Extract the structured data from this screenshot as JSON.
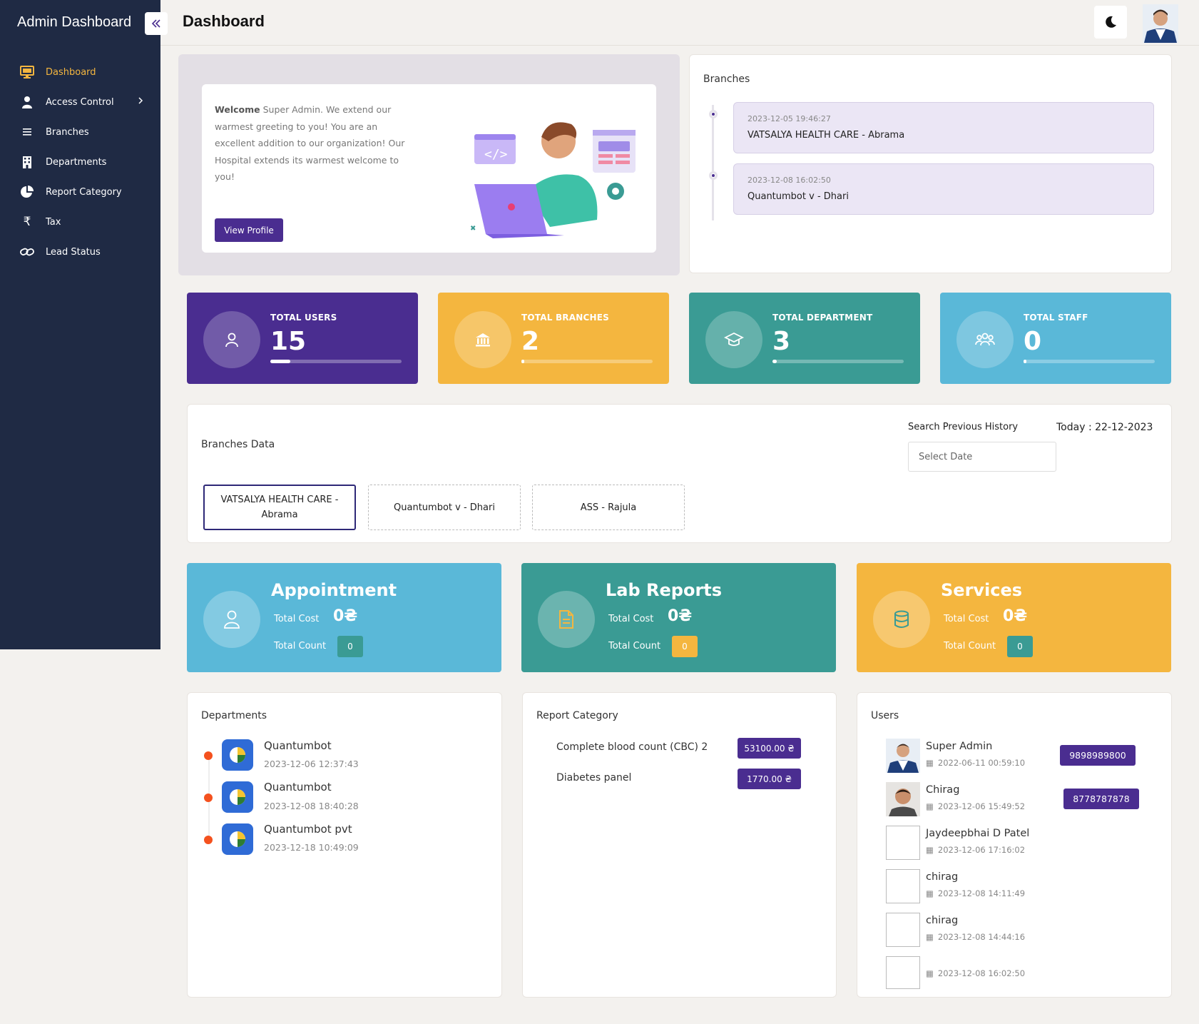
{
  "sidebar": {
    "brand": "Admin Dashboard",
    "items": [
      {
        "label": "Dashboard",
        "icon": "monitor-icon"
      },
      {
        "label": "Access Control",
        "icon": "user-icon"
      },
      {
        "label": "Branches",
        "icon": "list-icon"
      },
      {
        "label": "Departments",
        "icon": "building-icon"
      },
      {
        "label": "Report Category",
        "icon": "pie-chart-icon"
      },
      {
        "label": "Tax",
        "icon": "rupee-icon"
      },
      {
        "label": "Lead Status",
        "icon": "link-icon"
      }
    ]
  },
  "header": {
    "title": "Dashboard"
  },
  "welcome": {
    "strong": "Welcome",
    "text": " Super Admin. We extend our warmest greeting to you! You are an excellent addition to our organization! Our Hospital extends its warmest welcome to you!",
    "button": "View Profile"
  },
  "branches_panel": {
    "title": "Branches",
    "items": [
      {
        "date": "2023-12-05 19:46:27",
        "name": "VATSALYA HEALTH CARE - Abrama"
      },
      {
        "date": "2023-12-08 16:02:50",
        "name": "Quantumbot v - Dhari"
      }
    ]
  },
  "stats": [
    {
      "label": "TOTAL USERS",
      "value": "15",
      "progress": 0.15,
      "color": "#4a2d90",
      "icon": "user-icon"
    },
    {
      "label": "TOTAL BRANCHES",
      "value": "2",
      "progress": 0.02,
      "color": "#f4b63f",
      "icon": "bank-icon"
    },
    {
      "label": "TOTAL DEPARTMENT",
      "value": "3",
      "progress": 0.03,
      "color": "#3a9b94",
      "icon": "graduation-cap-icon"
    },
    {
      "label": "TOTAL STAFF",
      "value": "0",
      "progress": 0,
      "color": "#5ab8d8",
      "icon": "group-icon"
    }
  ],
  "branches_data": {
    "title": "Branches Data",
    "search_label": "Search Previous History",
    "today": "Today : 22-12-2023",
    "date_placeholder": "Select Date",
    "tabs": [
      "VATSALYA HEALTH CARE - Abrama",
      "Quantumbot v - Dhari",
      "ASS - Rajula"
    ]
  },
  "services": [
    {
      "title": "Appointment",
      "cost_label": "Total Cost",
      "cost": "0₴",
      "count_label": "Total Count",
      "count": "0",
      "color": "#5ab8d8",
      "badge_color": "#3a9b94",
      "icon": "user-icon"
    },
    {
      "title": "Lab Reports",
      "cost_label": "Total Cost",
      "cost": "0₴",
      "count_label": "Total Count",
      "count": "0",
      "color": "#3a9b94",
      "badge_color": "#f4b63f",
      "icon": "document-icon"
    },
    {
      "title": "Services",
      "cost_label": "Total Cost",
      "cost": "0₴",
      "count_label": "Total Count",
      "count": "0",
      "color": "#f4b63f",
      "badge_color": "#3a9b94",
      "icon": "database-icon"
    }
  ],
  "departments": {
    "title": "Departments",
    "items": [
      {
        "name": "Quantumbot",
        "date": "2023-12-06 12:37:43"
      },
      {
        "name": "Quantumbot",
        "date": "2023-12-08 18:40:28"
      },
      {
        "name": "Quantumbot pvt",
        "date": "2023-12-18 10:49:09"
      }
    ]
  },
  "report_category": {
    "title": "Report Category",
    "items": [
      {
        "name": "Complete blood count (CBC) 2",
        "price": "53100.00 ₴"
      },
      {
        "name": "Diabetes panel",
        "price": "1770.00 ₴"
      }
    ]
  },
  "users": {
    "title": "Users",
    "items": [
      {
        "name": "Super Admin",
        "date": "2022-06-11 00:59:10",
        "phone": "9898989800"
      },
      {
        "name": "Chirag",
        "date": "2023-12-06 15:49:52",
        "phone": "8778787878"
      },
      {
        "name": "Jaydeepbhai D Patel",
        "date": "2023-12-06 17:16:02",
        "phone": ""
      },
      {
        "name": "chirag",
        "date": "2023-12-08 14:11:49",
        "phone": ""
      },
      {
        "name": "chirag",
        "date": "2023-12-08 14:44:16",
        "phone": ""
      },
      {
        "name": "",
        "date": "2023-12-08 16:02:50",
        "phone": ""
      }
    ]
  }
}
